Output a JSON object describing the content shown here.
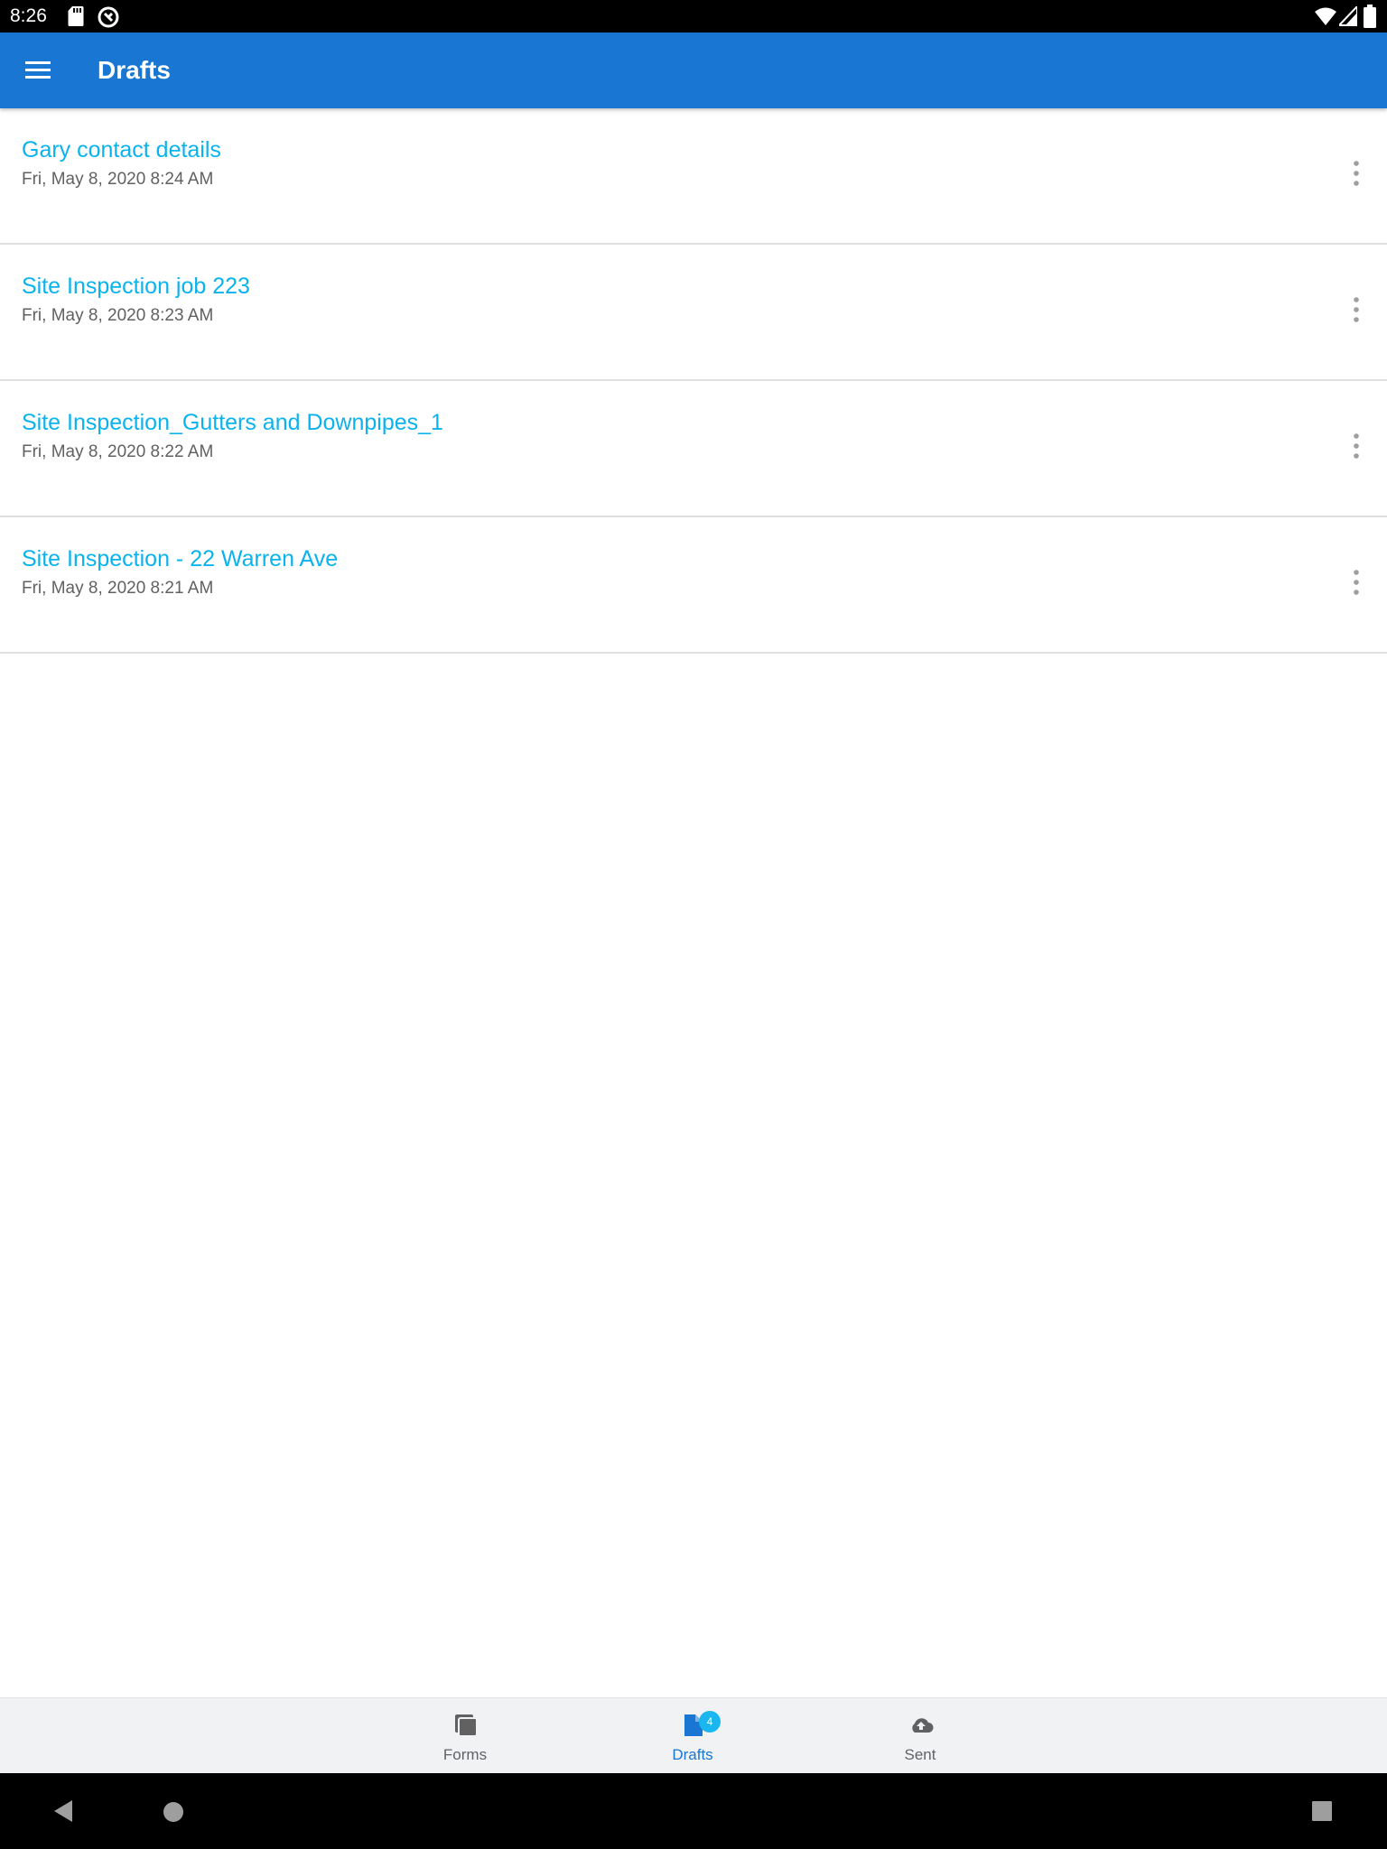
{
  "status_bar": {
    "time": "8:26",
    "icons": [
      "sd-card-icon",
      "sync-icon",
      "wifi-icon",
      "signal-icon",
      "battery-icon"
    ]
  },
  "app_bar": {
    "title": "Drafts",
    "menu_icon": "hamburger-menu-icon",
    "background": "#1976d2"
  },
  "drafts": [
    {
      "title": "Gary contact details",
      "date": "Fri, May 8, 2020 8:24 AM"
    },
    {
      "title": "Site Inspection job 223",
      "date": "Fri, May 8, 2020 8:23 AM"
    },
    {
      "title": "Site Inspection_Gutters and Downpipes_1",
      "date": "Fri, May 8, 2020 8:22 AM"
    },
    {
      "title": "Site Inspection - 22 Warren Ave",
      "date": "Fri, May 8, 2020 8:21 AM"
    }
  ],
  "bottom_nav": {
    "items": [
      {
        "label": "Forms",
        "icon": "forms-icon",
        "active": false
      },
      {
        "label": "Drafts",
        "icon": "drafts-icon",
        "active": true,
        "badge": "4"
      },
      {
        "label": "Sent",
        "icon": "cloud-upload-icon",
        "active": false
      }
    ],
    "active_color": "#1976d2",
    "badge_color": "#1ab6f0"
  },
  "system_nav": {
    "icons": [
      "back-icon",
      "home-icon",
      "recents-icon"
    ]
  },
  "colors": {
    "title_text": "#0ab3ee",
    "date_text": "#616161",
    "divider": "#e0e0e0"
  }
}
